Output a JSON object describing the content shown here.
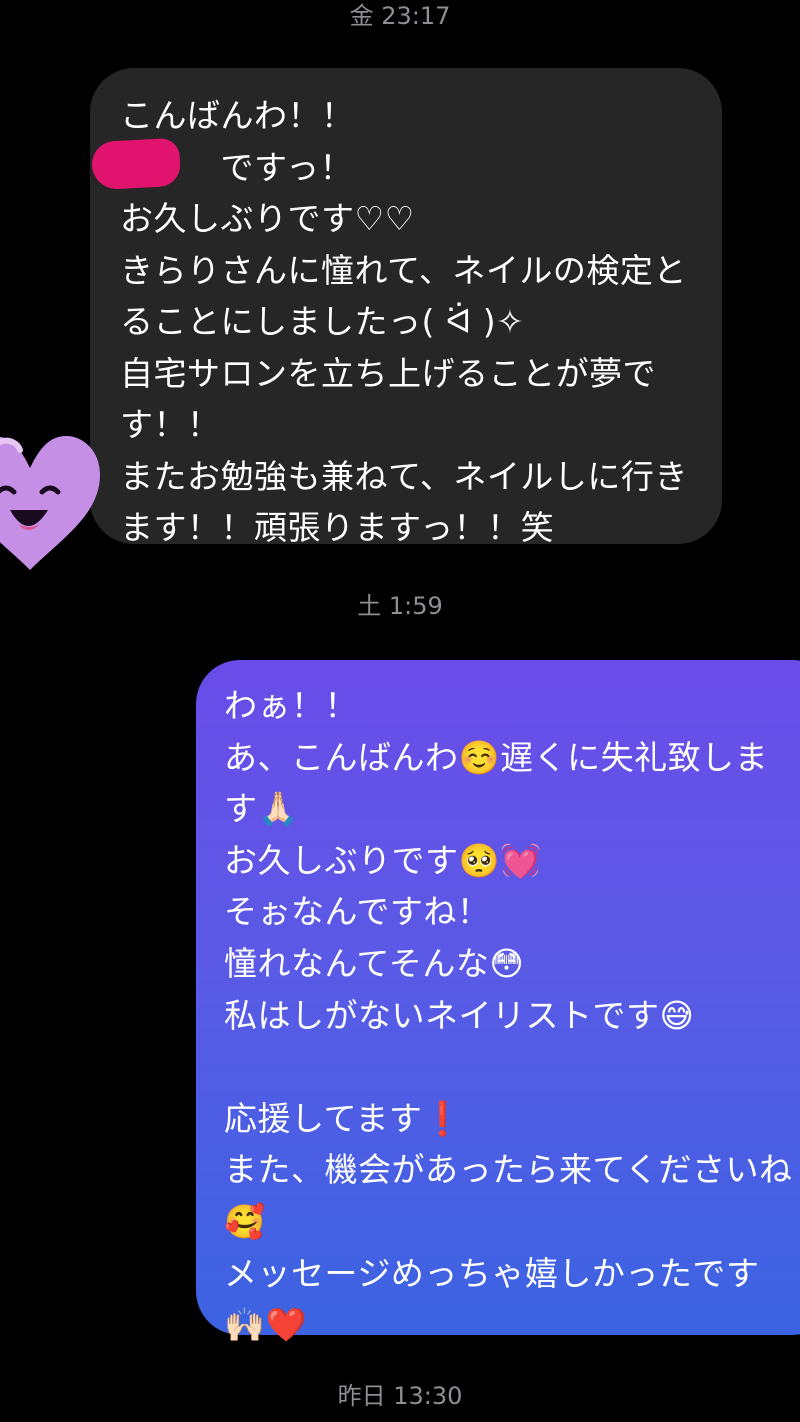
{
  "timestamps": {
    "first": "金 23:17",
    "second": "土 1:59",
    "third": "昨日 13:30"
  },
  "incoming_message": {
    "lines": [
      "こんばんわ！！",
      "　　　ですっ！",
      "お久しぶりです♡♡",
      "きらりさんに憧れて、ネイルの検定と",
      "ることにしましたっ( ᐛ )✧",
      "自宅サロンを立ち上げることが夢で",
      "す！！",
      "またお勉強も兼ねて、ネイルしに行き",
      "ます！！頑張りますっ！！笑"
    ]
  },
  "outgoing_message": {
    "lines": [
      "わぁ！！",
      "あ、こんばんわ☺️遅くに失礼致しま",
      "す🙏🏻",
      "お久しぶりです🥺💓",
      "そぉなんですね！",
      "憧れなんてそんな😳",
      "私はしがないネイリストです😅",
      "",
      "応援してます❗️",
      "また、機会があったら来てくださいね",
      "🥰",
      "メッセージめっちゃ嬉しかったです",
      "🙌🏻❤️"
    ]
  },
  "sticker": {
    "icon": "heart-face-sticker",
    "color": "#c58fe6"
  },
  "colors": {
    "background": "#000000",
    "incoming_bubble": "#262626",
    "outgoing_gradient_top": "#6a4ce8",
    "outgoing_gradient_bottom": "#3b63e2",
    "timestamp": "#8e8e93",
    "redaction": "#e0146e"
  }
}
